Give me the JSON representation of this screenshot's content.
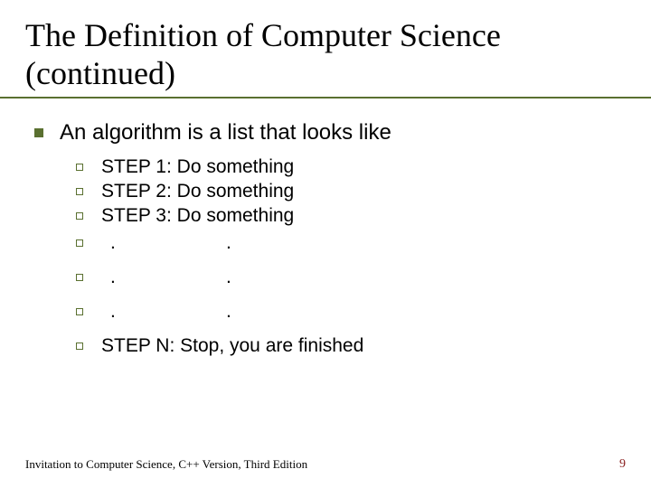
{
  "title": "The Definition of Computer Science (continued)",
  "main_bullet": "An algorithm is a list that looks like",
  "steps": {
    "s1": "STEP 1: Do something",
    "s2": "STEP 2: Do something",
    "s3": "STEP 3: Do something",
    "dot": ".",
    "sn": "STEP N: Stop, you are finished"
  },
  "footer": {
    "source": "Invitation to Computer Science, C++ Version, Third Edition",
    "page": "9"
  }
}
